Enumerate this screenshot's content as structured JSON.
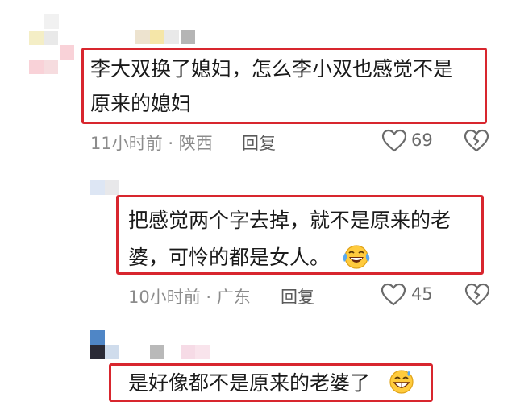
{
  "comments": [
    {
      "text_line1": "李大双换了媳妇，怎么李小双也感觉不是",
      "text_line2": "原来的媳妇",
      "time": "11小时前",
      "location": "陕西",
      "reply_label": "回复",
      "likes": "69",
      "like_icon": "heart-outline-icon",
      "dislike_icon": "broken-heart-icon"
    },
    {
      "text_line1": "把感觉两个字去掉，就不是原来的老",
      "text_line2": "婆，可怜的都是女人。",
      "emoji": "laughing-tears-emoji",
      "time": "10小时前",
      "location": "广东",
      "reply_label": "回复",
      "likes": "45",
      "like_icon": "heart-outline-icon",
      "dislike_icon": "broken-heart-icon"
    },
    {
      "text_line1": "是好像都不是原来的老婆了",
      "emoji": "grinning-sweat-emoji"
    }
  ],
  "meta_separator": " · ",
  "colors": {
    "highlight_border": "#d8262e",
    "meta_text": "#8c8c8c"
  }
}
